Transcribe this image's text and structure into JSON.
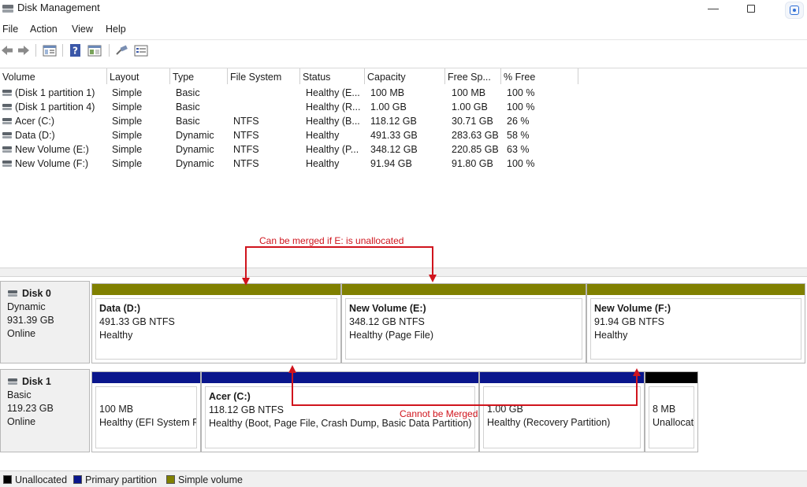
{
  "window": {
    "title": "Disk Management"
  },
  "menu": [
    "File",
    "Action",
    "View",
    "Help"
  ],
  "toolbar": [
    {
      "name": "back-arrow-icon"
    },
    {
      "name": "forward-arrow-icon"
    },
    {
      "name": "properties-icon"
    },
    {
      "name": "help-icon"
    },
    {
      "name": "console-tree-icon"
    },
    {
      "name": "connect-disk-icon"
    },
    {
      "name": "list-view-icon"
    }
  ],
  "volume_list": {
    "columns": [
      "Volume",
      "Layout",
      "Type",
      "File System",
      "Status",
      "Capacity",
      "Free Sp...",
      "% Free"
    ],
    "rows": [
      [
        "(Disk 1 partition 1)",
        "Simple",
        "Basic",
        "",
        "Healthy (E...",
        "100 MB",
        "100 MB",
        "100 %"
      ],
      [
        "(Disk 1 partition 4)",
        "Simple",
        "Basic",
        "",
        "Healthy (R...",
        "1.00 GB",
        "1.00 GB",
        "100 %"
      ],
      [
        "Acer (C:)",
        "Simple",
        "Basic",
        "NTFS",
        "Healthy (B...",
        "118.12 GB",
        "30.71 GB",
        "26 %"
      ],
      [
        "Data (D:)",
        "Simple",
        "Dynamic",
        "NTFS",
        "Healthy",
        "491.33 GB",
        "283.63 GB",
        "58 %"
      ],
      [
        "New Volume (E:)",
        "Simple",
        "Dynamic",
        "NTFS",
        "Healthy (P...",
        "348.12 GB",
        "220.85 GB",
        "63 %"
      ],
      [
        "New Volume (F:)",
        "Simple",
        "Dynamic",
        "NTFS",
        "Healthy",
        "91.94 GB",
        "91.80 GB",
        "100 %"
      ]
    ]
  },
  "disks": [
    {
      "name": "Disk 0",
      "type": "Dynamic",
      "size": "931.39 GB",
      "state": "Online",
      "partitions": [
        {
          "name": "Data  (D:)",
          "size": "491.33 GB NTFS",
          "status": "Healthy",
          "kind": "simple"
        },
        {
          "name": "New Volume  (E:)",
          "size": "348.12 GB NTFS",
          "status": "Healthy (Page File)",
          "kind": "simple"
        },
        {
          "name": "New Volume  (F:)",
          "size": "91.94 GB NTFS",
          "status": "Healthy",
          "kind": "simple"
        }
      ]
    },
    {
      "name": "Disk 1",
      "type": "Basic",
      "size": "119.23 GB",
      "state": "Online",
      "partitions": [
        {
          "name": "",
          "size": "100 MB",
          "status": "Healthy (EFI System P",
          "kind": "primary"
        },
        {
          "name": "Acer  (C:)",
          "size": "118.12 GB NTFS",
          "status": "Healthy (Boot, Page File, Crash Dump, Basic Data Partition)",
          "kind": "primary"
        },
        {
          "name": "",
          "size": "1.00 GB",
          "status": "Healthy (Recovery Partition)",
          "kind": "primary"
        },
        {
          "name": "",
          "size": "8 MB",
          "status": "Unallocat",
          "kind": "unallocated"
        }
      ]
    }
  ],
  "legend": [
    {
      "label": "Unallocated",
      "color": "#000000"
    },
    {
      "label": "Primary partition",
      "color": "#0a168c"
    },
    {
      "label": "Simple volume",
      "color": "#808000"
    }
  ],
  "annotations": {
    "merge_ok": "Can be merged if E: is unallocated",
    "merge_no": "Cannot be Merged",
    "color": "#d0141d"
  },
  "colors": {
    "simple": "#808000",
    "primary": "#0a168c",
    "unallocated": "#000000"
  }
}
